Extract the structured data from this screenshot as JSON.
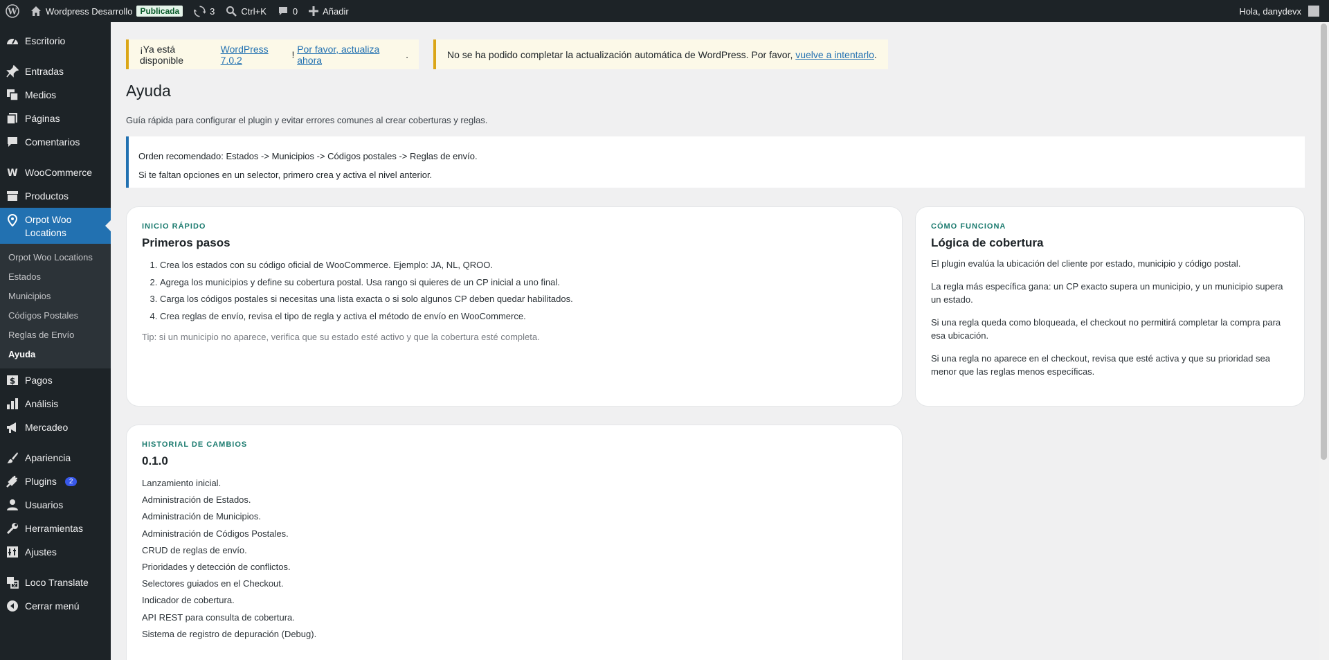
{
  "adminbar": {
    "site_name": "Wordpress Desarrollo",
    "status_badge": "Publicada",
    "updates_count": "3",
    "search_shortcut": "Ctrl+K",
    "comments_count": "0",
    "add_new": "Añadir",
    "greeting": "Hola, danydevx"
  },
  "sidebar": {
    "items": [
      {
        "label": "Escritorio",
        "icon": "dashboard-icon"
      },
      {
        "label": "Entradas",
        "icon": "pin-icon"
      },
      {
        "label": "Medios",
        "icon": "media-icon"
      },
      {
        "label": "Páginas",
        "icon": "pages-icon"
      },
      {
        "label": "Comentarios",
        "icon": "comment-icon"
      },
      {
        "label": "WooCommerce",
        "icon": "woo-icon"
      },
      {
        "label": "Productos",
        "icon": "archive-icon"
      },
      {
        "label": "Orpot Woo Locations",
        "icon": "location-pin-icon"
      },
      {
        "label": "Pagos",
        "icon": "dollar-icon"
      },
      {
        "label": "Análisis",
        "icon": "chart-icon"
      },
      {
        "label": "Mercadeo",
        "icon": "megaphone-icon"
      },
      {
        "label": "Apariencia",
        "icon": "brush-icon"
      },
      {
        "label": "Plugins",
        "icon": "plug-icon",
        "badge": "2"
      },
      {
        "label": "Usuarios",
        "icon": "user-icon"
      },
      {
        "label": "Herramientas",
        "icon": "wrench-icon"
      },
      {
        "label": "Ajustes",
        "icon": "settings-icon"
      },
      {
        "label": "Loco Translate",
        "icon": "translate-icon"
      },
      {
        "label": "Cerrar menú",
        "icon": "collapse-icon"
      }
    ],
    "submenu": [
      "Orpot Woo Locations",
      "Estados",
      "Municipios",
      "Códigos Postales",
      "Reglas de Envío",
      "Ayuda"
    ]
  },
  "notices": {
    "update": {
      "pre": "¡Ya está disponible ",
      "link1": "WordPress 7.0.2",
      "mid": "! ",
      "link2": "Por favor, actualiza ahora",
      "post": "."
    },
    "failed": {
      "pre": "No se ha podido completar la actualización automática de WordPress. Por favor, ",
      "link": "vuelve a intentarlo",
      "post": "."
    }
  },
  "page": {
    "title": "Ayuda",
    "intro": "Guía rápida para configurar el plugin y evitar errores comunes al crear coberturas y reglas.",
    "callout": [
      "Orden recomendado: Estados -> Municipios -> Códigos postales -> Reglas de envío.",
      "Si te faltan opciones en un selector, primero crea y activa el nivel anterior."
    ]
  },
  "quickstart": {
    "eyebrow": "INICIO RÁPIDO",
    "title": "Primeros pasos",
    "steps": [
      "Crea los estados con su código oficial de WooCommerce. Ejemplo: JA, NL, QROO.",
      "Agrega los municipios y define su cobertura postal. Usa rango si quieres de un CP inicial a uno final.",
      "Carga los códigos postales si necesitas una lista exacta o si solo algunos CP deben quedar habilitados.",
      "Crea reglas de envío, revisa el tipo de regla y activa el método de envío en WooCommerce."
    ],
    "tip": "Tip: si un municipio no aparece, verifica que su estado esté activo y que la cobertura esté completa."
  },
  "howitworks": {
    "eyebrow": "CÓMO FUNCIONA",
    "title": "Lógica de cobertura",
    "paragraphs": [
      "El plugin evalúa la ubicación del cliente por estado, municipio y código postal.",
      "La regla más específica gana: un CP exacto supera un municipio, y un municipio supera un estado.",
      "Si una regla queda como bloqueada, el checkout no permitirá completar la compra para esa ubicación.",
      "Si una regla no aparece en el checkout, revisa que esté activa y que su prioridad sea menor que las reglas menos específicas."
    ]
  },
  "changelog": {
    "eyebrow": "HISTORIAL DE CAMBIOS",
    "title": "0.1.0",
    "entries": [
      "Lanzamiento inicial.",
      "Administración de Estados.",
      "Administración de Municipios.",
      "Administración de Códigos Postales.",
      "CRUD de reglas de envío.",
      "Prioridades y detección de conflictos.",
      "Selectores guiados en el Checkout.",
      "Indicador de cobertura.",
      "API REST para consulta de cobertura.",
      "Sistema de registro de depuración (Debug)."
    ]
  }
}
